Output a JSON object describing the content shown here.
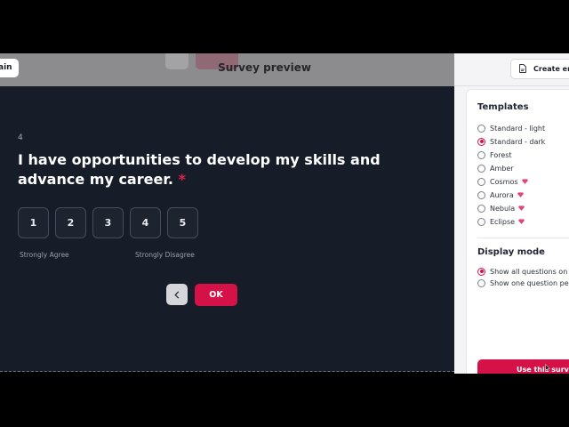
{
  "header": {
    "left_button_label": "ain",
    "title": "Survey preview",
    "create_button_label": "Create em"
  },
  "question": {
    "number": "4",
    "text": "I have opportunities to develop my skills and advance my career.",
    "required_marker": "*",
    "scale_options": [
      "1",
      "2",
      "3",
      "4",
      "5"
    ],
    "scale_low_label": "Strongly Agree",
    "scale_high_label": "Strongly Disagree"
  },
  "navigation": {
    "back_icon": "chevron-left-icon",
    "ok_label": "OK"
  },
  "panel": {
    "templates_title": "Templates",
    "templates": [
      {
        "label": "Standard - light",
        "selected": false,
        "premium": false
      },
      {
        "label": "Standard - dark",
        "selected": true,
        "premium": false
      },
      {
        "label": "Forest",
        "selected": false,
        "premium": false
      },
      {
        "label": "Amber",
        "selected": false,
        "premium": false
      },
      {
        "label": "Cosmos",
        "selected": false,
        "premium": true
      },
      {
        "label": "Aurora",
        "selected": false,
        "premium": true
      },
      {
        "label": "Nebula",
        "selected": false,
        "premium": true
      },
      {
        "label": "Eclipse",
        "selected": false,
        "premium": true
      }
    ],
    "display_mode_title": "Display mode",
    "display_modes": [
      {
        "label": "Show all questions on o",
        "selected": true
      },
      {
        "label": "Show one question per p",
        "selected": false
      }
    ],
    "use_button_label": "Use this survey"
  },
  "colors": {
    "accent": "#d51248",
    "survey_background": "#171d28",
    "overlay_header": "#8c8c8e"
  }
}
